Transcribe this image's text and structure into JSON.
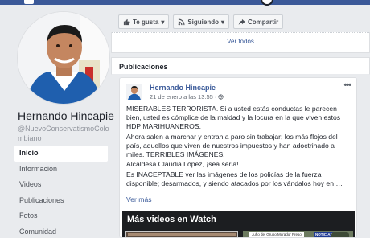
{
  "profile": {
    "name": "Hernando Hincapie",
    "handle": "@NuevoConservatismoColombiano"
  },
  "nav": {
    "items": [
      {
        "label": "Inicio",
        "active": true
      },
      {
        "label": "Información"
      },
      {
        "label": "Videos"
      },
      {
        "label": "Publicaciones"
      },
      {
        "label": "Fotos"
      },
      {
        "label": "Comunidad"
      }
    ]
  },
  "actions": {
    "like_label": "Te gusta",
    "follow_label": "Siguiendo",
    "share_label": "Compartir"
  },
  "card_top": {
    "see_all": "Ver todos"
  },
  "publicaciones": {
    "heading": "Publicaciones"
  },
  "post": {
    "author": "Hernando Hincapie",
    "timestamp": "21 de enero a las 13:55 ·",
    "menu_glyph": "•••",
    "paragraphs": [
      "MISERABLES TERRORISTA. Si a usted estás conductas le parecen bien, usted es cómplice de la maldad y la locura en la que viven estos HDP MARIHUANEROS.",
      "Ahora salen a marchar y entran a paro sin trabajar; los más flojos del país, aquellos que viven de nuestros impuestos y han adoctrinado a miles. TERRIBLES IMÁGENES.",
      "Alcaldesa Claudia López, ¡sea seria!",
      "Es INACEPTABLE ver las imágenes de los policías de la fuerza disponible; desarmados, y siendo atacados por los vándalos hoy en …"
    ],
    "see_more": "Ver más"
  },
  "watch": {
    "title": "Más videos en Watch",
    "thumb_label": "Juho del Grupo Murador Preso",
    "thumb_badge": "NOTICIAS"
  },
  "colors": {
    "brand": "#3b5998",
    "link": "#385898",
    "background": "#e9ebee"
  }
}
